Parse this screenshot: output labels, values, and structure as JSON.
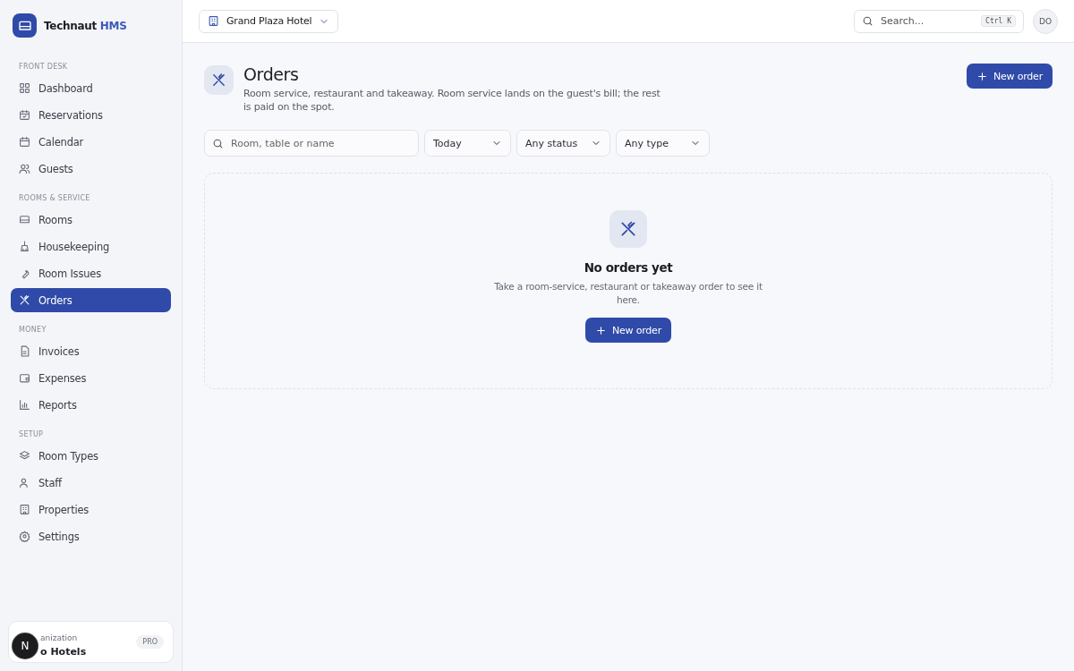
{
  "brand": {
    "name": "Technaut",
    "suffix": "HMS"
  },
  "sidebar": {
    "sections": [
      {
        "title": "FRONT DESK",
        "items": [
          {
            "label": "Dashboard",
            "selected": false
          },
          {
            "label": "Reservations",
            "selected": false
          },
          {
            "label": "Calendar",
            "selected": false
          },
          {
            "label": "Guests",
            "selected": false
          }
        ]
      },
      {
        "title": "ROOMS & SERVICE",
        "items": [
          {
            "label": "Rooms",
            "selected": false
          },
          {
            "label": "Housekeeping",
            "selected": false
          },
          {
            "label": "Room Issues",
            "selected": false
          },
          {
            "label": "Orders",
            "selected": true
          }
        ]
      },
      {
        "title": "MONEY",
        "items": [
          {
            "label": "Invoices",
            "selected": false
          },
          {
            "label": "Expenses",
            "selected": false
          },
          {
            "label": "Reports",
            "selected": false
          }
        ]
      },
      {
        "title": "SETUP",
        "items": [
          {
            "label": "Room Types",
            "selected": false
          },
          {
            "label": "Staff",
            "selected": false
          },
          {
            "label": "Properties",
            "selected": false
          },
          {
            "label": "Settings",
            "selected": false
          }
        ]
      }
    ]
  },
  "organization": {
    "label": "anization",
    "name": "o Hotels",
    "plan": "PRO"
  },
  "dev_badge": "N",
  "header": {
    "property": "Grand Plaza Hotel",
    "search": {
      "placeholder": "Search...",
      "shortcut": "Ctrl K"
    },
    "avatar": "DO"
  },
  "page": {
    "title": "Orders",
    "description": "Room service, restaurant and takeaway. Room service lands on the guest's bill; the rest is paid on the spot.",
    "action": "New order"
  },
  "filters": {
    "search": {
      "placeholder": "Room, table or name"
    },
    "selects": [
      "Today",
      "Any status",
      "Any type"
    ]
  },
  "empty_state": {
    "title": "No orders yet",
    "message": "Take a room-service, restaurant or takeaway order to see it here.",
    "action": "New order"
  }
}
